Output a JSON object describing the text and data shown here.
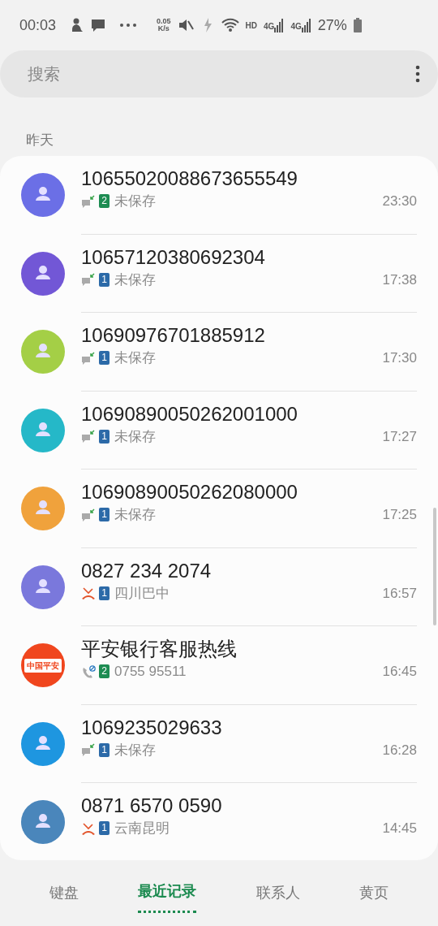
{
  "status_bar": {
    "time": "00:03",
    "speed": "0.05\nK/s",
    "hd": "HD",
    "net1": "4G",
    "net2": "4G",
    "battery": "27%"
  },
  "search": {
    "placeholder": "搜索"
  },
  "section": "昨天",
  "calls": [
    {
      "number": "10655020088673655549",
      "kind": "sms",
      "sim": {
        "label": "2",
        "color": "#1d8c52"
      },
      "detail": "未保存",
      "time": "23:30",
      "avatar": {
        "kind": "person",
        "color": "#6b6fe6"
      }
    },
    {
      "number": "10657120380692304",
      "kind": "sms",
      "sim": {
        "label": "1",
        "color": "#2c6aa8"
      },
      "detail": "未保存",
      "time": "17:38",
      "avatar": {
        "kind": "person",
        "color": "#7257d6"
      }
    },
    {
      "number": "10690976701885912",
      "kind": "sms",
      "sim": {
        "label": "1",
        "color": "#2c6aa8"
      },
      "detail": "未保存",
      "time": "17:30",
      "avatar": {
        "kind": "person",
        "color": "#a4cf46"
      }
    },
    {
      "number": "10690890050262001000",
      "kind": "sms",
      "sim": {
        "label": "1",
        "color": "#2c6aa8"
      },
      "detail": "未保存",
      "time": "17:27",
      "avatar": {
        "kind": "person",
        "color": "#25b8c8"
      }
    },
    {
      "number": "10690890050262080000",
      "kind": "sms",
      "sim": {
        "label": "1",
        "color": "#2c6aa8"
      },
      "detail": "未保存",
      "time": "17:25",
      "avatar": {
        "kind": "person",
        "color": "#f0a23c"
      }
    },
    {
      "number": "0827 234 2074",
      "kind": "missed",
      "sim": {
        "label": "1",
        "color": "#2c6aa8"
      },
      "detail": "四川巴中",
      "time": "16:57",
      "avatar": {
        "kind": "person",
        "color": "#7a78dc"
      }
    },
    {
      "number": "平安银行客服热线",
      "kind": "blocked",
      "sim": {
        "label": "2",
        "color": "#1d8c52"
      },
      "detail": "0755 95511",
      "time": "16:45",
      "avatar": {
        "kind": "logo",
        "color": "#f0461e",
        "text": "中国平安"
      }
    },
    {
      "number": "1069235029633",
      "kind": "sms",
      "sim": {
        "label": "1",
        "color": "#2c6aa8"
      },
      "detail": "未保存",
      "time": "16:28",
      "avatar": {
        "kind": "person",
        "color": "#1e96e0"
      }
    },
    {
      "number": "0871 6570 0590",
      "kind": "missed",
      "sim": {
        "label": "1",
        "color": "#2c6aa8"
      },
      "detail": "云南昆明",
      "time": "14:45",
      "avatar": {
        "kind": "person",
        "color": "#4a86bb"
      }
    }
  ],
  "tabs": [
    {
      "label": "键盘",
      "selected": false
    },
    {
      "label": "最近记录",
      "selected": true
    },
    {
      "label": "联系人",
      "selected": false
    },
    {
      "label": "黄页",
      "selected": false
    }
  ]
}
